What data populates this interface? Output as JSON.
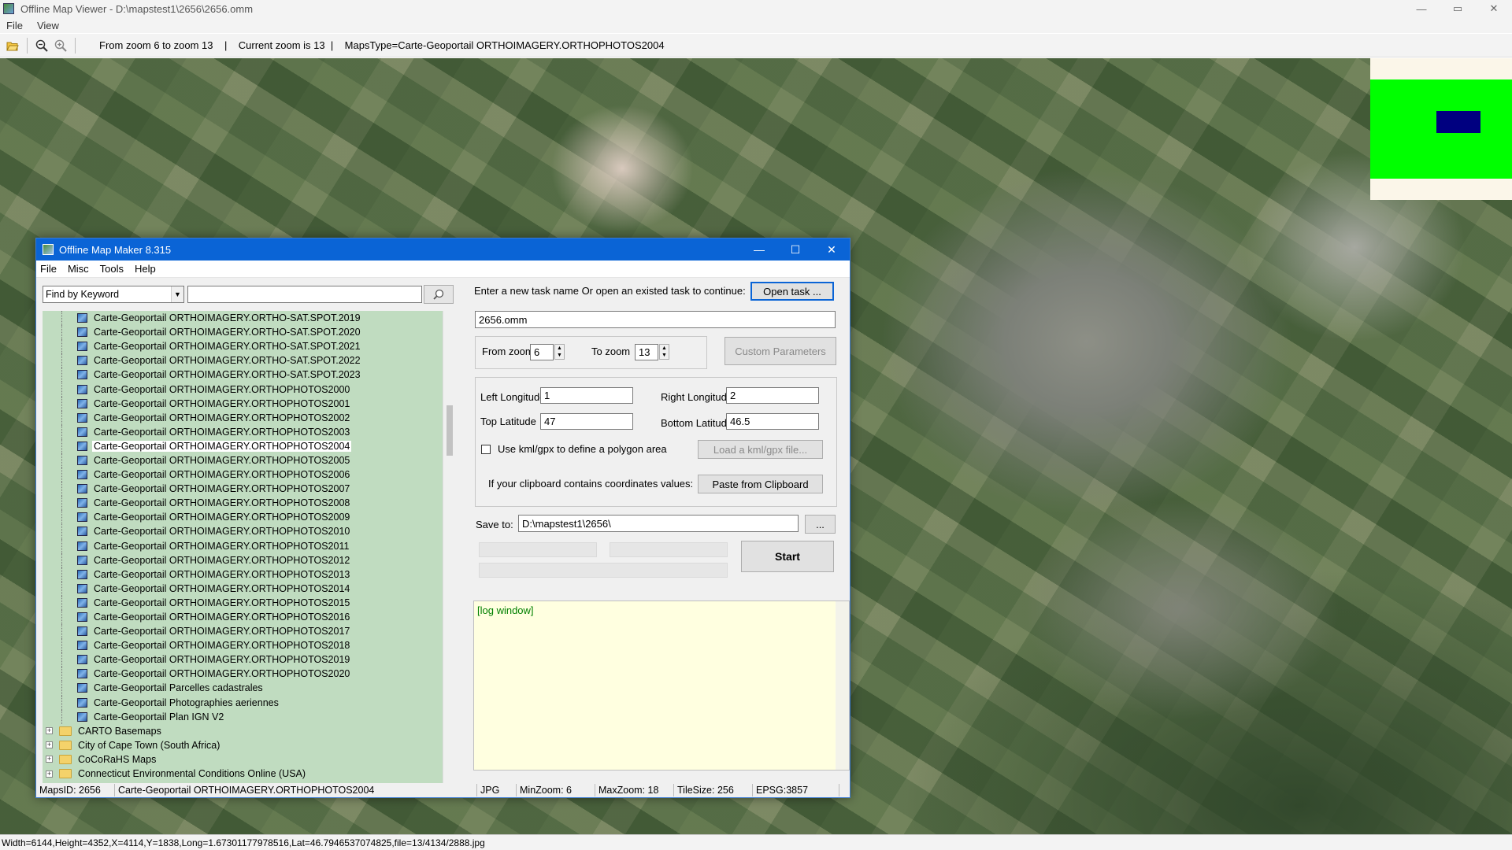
{
  "window": {
    "title": "Offline Map Viewer - D:\\mapstest1\\2656\\2656.omm",
    "controls": {
      "minimize": "—",
      "maximize": "▭",
      "close": "✕"
    }
  },
  "menu": {
    "file": "File",
    "view": "View"
  },
  "toolbar": {
    "info": "From zoom 6 to zoom 13    |    Current zoom is 13  |    MapsType=Carte-Geoportail ORTHOIMAGERY.ORTHOPHOTOS2004"
  },
  "status": {
    "text": "Width=6144,Height=4352,X=4114,Y=1838,Long=1.67301177978516,Lat=46.7946537074825,file=13/4134/2888.jpg"
  },
  "dialog": {
    "title": "Offline Map Maker 8.315",
    "controls": {
      "minimize": "—",
      "maximize": "☐",
      "close": "✕"
    },
    "menu": {
      "file": "File",
      "misc": "Misc",
      "tools": "Tools",
      "help": "Help"
    },
    "find_by": "Find by Keyword",
    "search_value": "",
    "tree": {
      "children": [
        "Carte-Geoportail ORTHOIMAGERY.ORTHO-SAT.SPOT.2019",
        "Carte-Geoportail ORTHOIMAGERY.ORTHO-SAT.SPOT.2020",
        "Carte-Geoportail ORTHOIMAGERY.ORTHO-SAT.SPOT.2021",
        "Carte-Geoportail ORTHOIMAGERY.ORTHO-SAT.SPOT.2022",
        "Carte-Geoportail ORTHOIMAGERY.ORTHO-SAT.SPOT.2023",
        "Carte-Geoportail ORTHOIMAGERY.ORTHOPHOTOS2000",
        "Carte-Geoportail ORTHOIMAGERY.ORTHOPHOTOS2001",
        "Carte-Geoportail ORTHOIMAGERY.ORTHOPHOTOS2002",
        "Carte-Geoportail ORTHOIMAGERY.ORTHOPHOTOS2003",
        "Carte-Geoportail ORTHOIMAGERY.ORTHOPHOTOS2004",
        "Carte-Geoportail ORTHOIMAGERY.ORTHOPHOTOS2005",
        "Carte-Geoportail ORTHOIMAGERY.ORTHOPHOTOS2006",
        "Carte-Geoportail ORTHOIMAGERY.ORTHOPHOTOS2007",
        "Carte-Geoportail ORTHOIMAGERY.ORTHOPHOTOS2008",
        "Carte-Geoportail ORTHOIMAGERY.ORTHOPHOTOS2009",
        "Carte-Geoportail ORTHOIMAGERY.ORTHOPHOTOS2010",
        "Carte-Geoportail ORTHOIMAGERY.ORTHOPHOTOS2011",
        "Carte-Geoportail ORTHOIMAGERY.ORTHOPHOTOS2012",
        "Carte-Geoportail ORTHOIMAGERY.ORTHOPHOTOS2013",
        "Carte-Geoportail ORTHOIMAGERY.ORTHOPHOTOS2014",
        "Carte-Geoportail ORTHOIMAGERY.ORTHOPHOTOS2015",
        "Carte-Geoportail ORTHOIMAGERY.ORTHOPHOTOS2016",
        "Carte-Geoportail ORTHOIMAGERY.ORTHOPHOTOS2017",
        "Carte-Geoportail ORTHOIMAGERY.ORTHOPHOTOS2018",
        "Carte-Geoportail ORTHOIMAGERY.ORTHOPHOTOS2019",
        "Carte-Geoportail ORTHOIMAGERY.ORTHOPHOTOS2020",
        "Carte-Geoportail Parcelles cadastrales",
        "Carte-Geoportail Photographies aeriennes",
        "Carte-Geoportail Plan IGN V2"
      ],
      "selected": "Carte-Geoportail ORTHOIMAGERY.ORTHOPHOTOS2004",
      "folders": [
        "CARTO Basemaps",
        "City of Cape Town (South Africa)",
        "CoCoRaHS Maps",
        "Connecticut Environmental Conditions Online (USA)"
      ],
      "expander": "+"
    },
    "task_prompt": "Enter a new task name Or open an existed task to continue:",
    "open_task": "Open task ...",
    "task_name": "2656.omm",
    "from_zoom_label": "From zoom",
    "from_zoom": "6",
    "to_zoom_label": "To zoom",
    "to_zoom": "13",
    "custom_params": "Custom Parameters",
    "left_lon_label": "Left Longitude",
    "left_lon": "1",
    "right_lon_label": "Right Longitude",
    "right_lon": "2",
    "top_lat_label": "Top Latitude",
    "top_lat": "47",
    "bottom_lat_label": "Bottom Latitude",
    "bottom_lat": "46.5",
    "use_kml_label": "Use kml/gpx to define a polygon area",
    "use_kml_checked": false,
    "load_kml": "Load a kml/gpx file...",
    "clipboard_label": "If your clipboard contains coordinates values:",
    "paste_clipboard": "Paste from Clipboard",
    "save_to_label": "Save to:",
    "save_to": "D:\\mapstest1\\2656\\",
    "browse": "...",
    "start": "Start",
    "log_text": "[log window]",
    "status": {
      "maps_id": "MapsID: 2656",
      "map_name": "Carte-Geoportail ORTHOIMAGERY.ORTHOPHOTOS2004",
      "format": "JPG",
      "min_zoom": "MinZoom: 6",
      "max_zoom": "MaxZoom: 18",
      "tile_size": "TileSize: 256",
      "epsg": "EPSG:3857"
    }
  },
  "colors": {
    "tree_bg": "#c0dcc0",
    "log_bg": "#ffffe0",
    "overview_green": "#00ff00",
    "overview_viewport": "#000080",
    "dialog_title": "#0a64d6"
  },
  "icons": {
    "open": "folder-open-icon",
    "zoom_out": "zoom-out-icon",
    "zoom_in": "zoom-in-icon",
    "search": "search-icon"
  }
}
